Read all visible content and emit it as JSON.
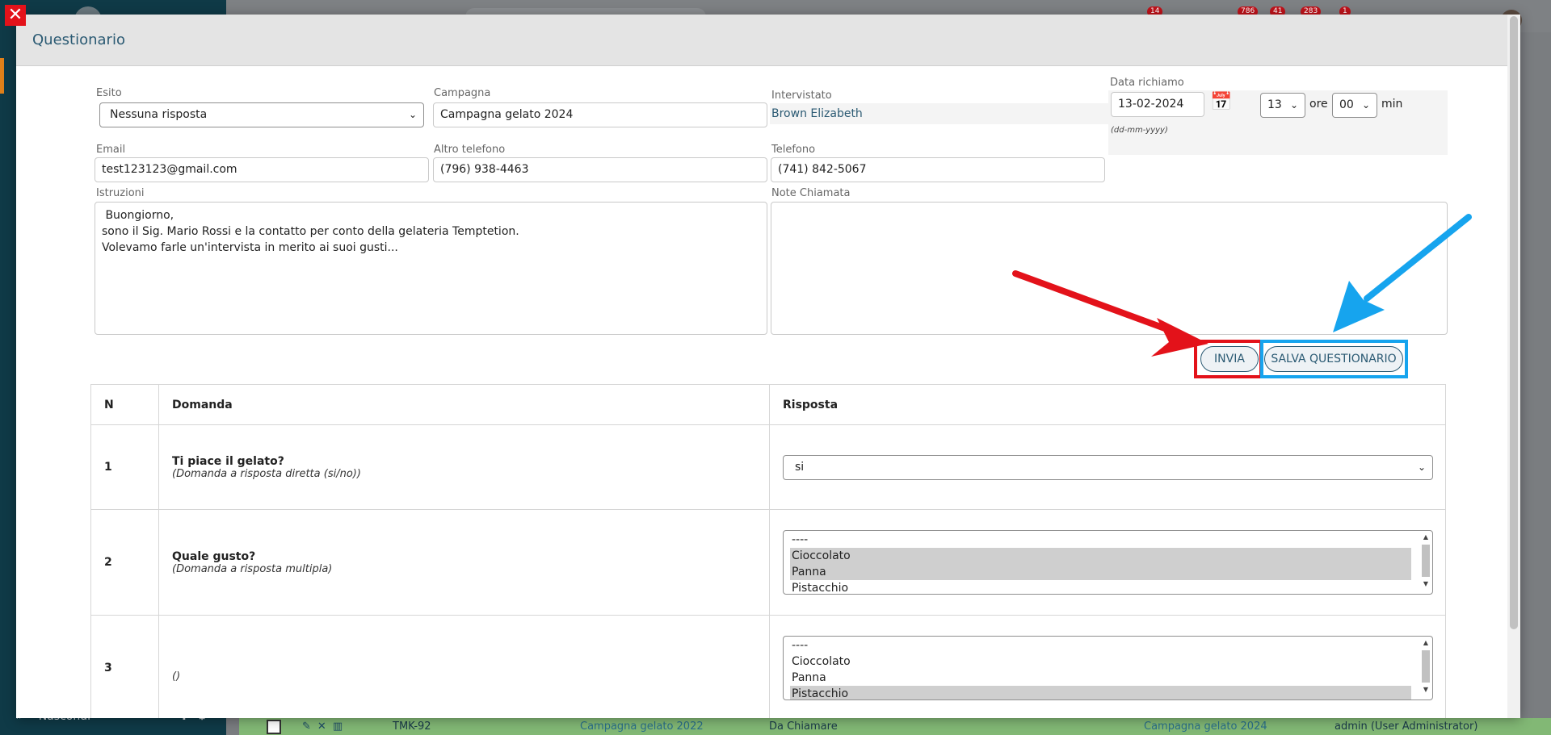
{
  "background": {
    "badges": [
      "14",
      "786",
      "41",
      "283",
      "1"
    ],
    "bottom_left_label": "Nascondi",
    "row": {
      "code": "TMK-92",
      "campaign": "Campagna gelato 2022",
      "status": "Da Chiamare",
      "campaign2": "Campagna gelato 2024",
      "user": "admin (User Administrator)"
    }
  },
  "modal": {
    "title": "Questionario",
    "close_symbol": "✕"
  },
  "form": {
    "esito": {
      "label": "Esito",
      "value": "Nessuna risposta"
    },
    "campagna": {
      "label": "Campagna",
      "value": "Campagna gelato 2024"
    },
    "intervistato": {
      "label": "Intervistato",
      "value": "Brown Elizabeth"
    },
    "data_richiamo": {
      "label": "Data richiamo",
      "value": "13-02-2024",
      "format_hint": "(dd-mm-yyyy)",
      "hour": "13",
      "hour_unit": "ore",
      "minute": "00",
      "minute_unit": "min"
    },
    "email": {
      "label": "Email",
      "value": "test123123@gmail.com"
    },
    "altro_telefono": {
      "label": "Altro telefono",
      "value": "(796) 938-4463"
    },
    "telefono": {
      "label": "Telefono",
      "value": "(741) 842-5067"
    },
    "istruzioni": {
      "label": "Istruzioni",
      "value": " Buongiorno,\nsono il Sig. Mario Rossi e la contatto per conto della gelateria Temptetion.\nVolevamo farle un'intervista in merito ai suoi gusti..."
    },
    "note_chiamata": {
      "label": "Note Chiamata",
      "value": ""
    }
  },
  "buttons": {
    "invia": "INVIA",
    "salva": "SALVA QUESTIONARIO"
  },
  "table": {
    "headers": {
      "n": "N",
      "domanda": "Domanda",
      "risposta": "Risposta"
    },
    "rows": [
      {
        "n": "1",
        "question": "Ti piace il gelato?",
        "hint": "(Domanda a risposta diretta (si/no))",
        "answer": "si"
      },
      {
        "n": "2",
        "question": "Quale gusto?",
        "hint": "(Domanda a risposta multipla)",
        "options": [
          "----",
          "Cioccolato",
          "Panna",
          "Pistacchio"
        ],
        "selected": [
          "Cioccolato",
          "Panna"
        ]
      },
      {
        "n": "3",
        "question": "",
        "hint": "()",
        "options": [
          "----",
          "Cioccolato",
          "Panna",
          "Pistacchio"
        ],
        "selected": [
          "Pistacchio"
        ]
      }
    ]
  },
  "colors": {
    "accent": "#2b5a73",
    "highlight_red": "#e3121a",
    "highlight_blue": "#16a4ee",
    "arrow_red": "#e3121a",
    "arrow_blue": "#16a4ee"
  }
}
